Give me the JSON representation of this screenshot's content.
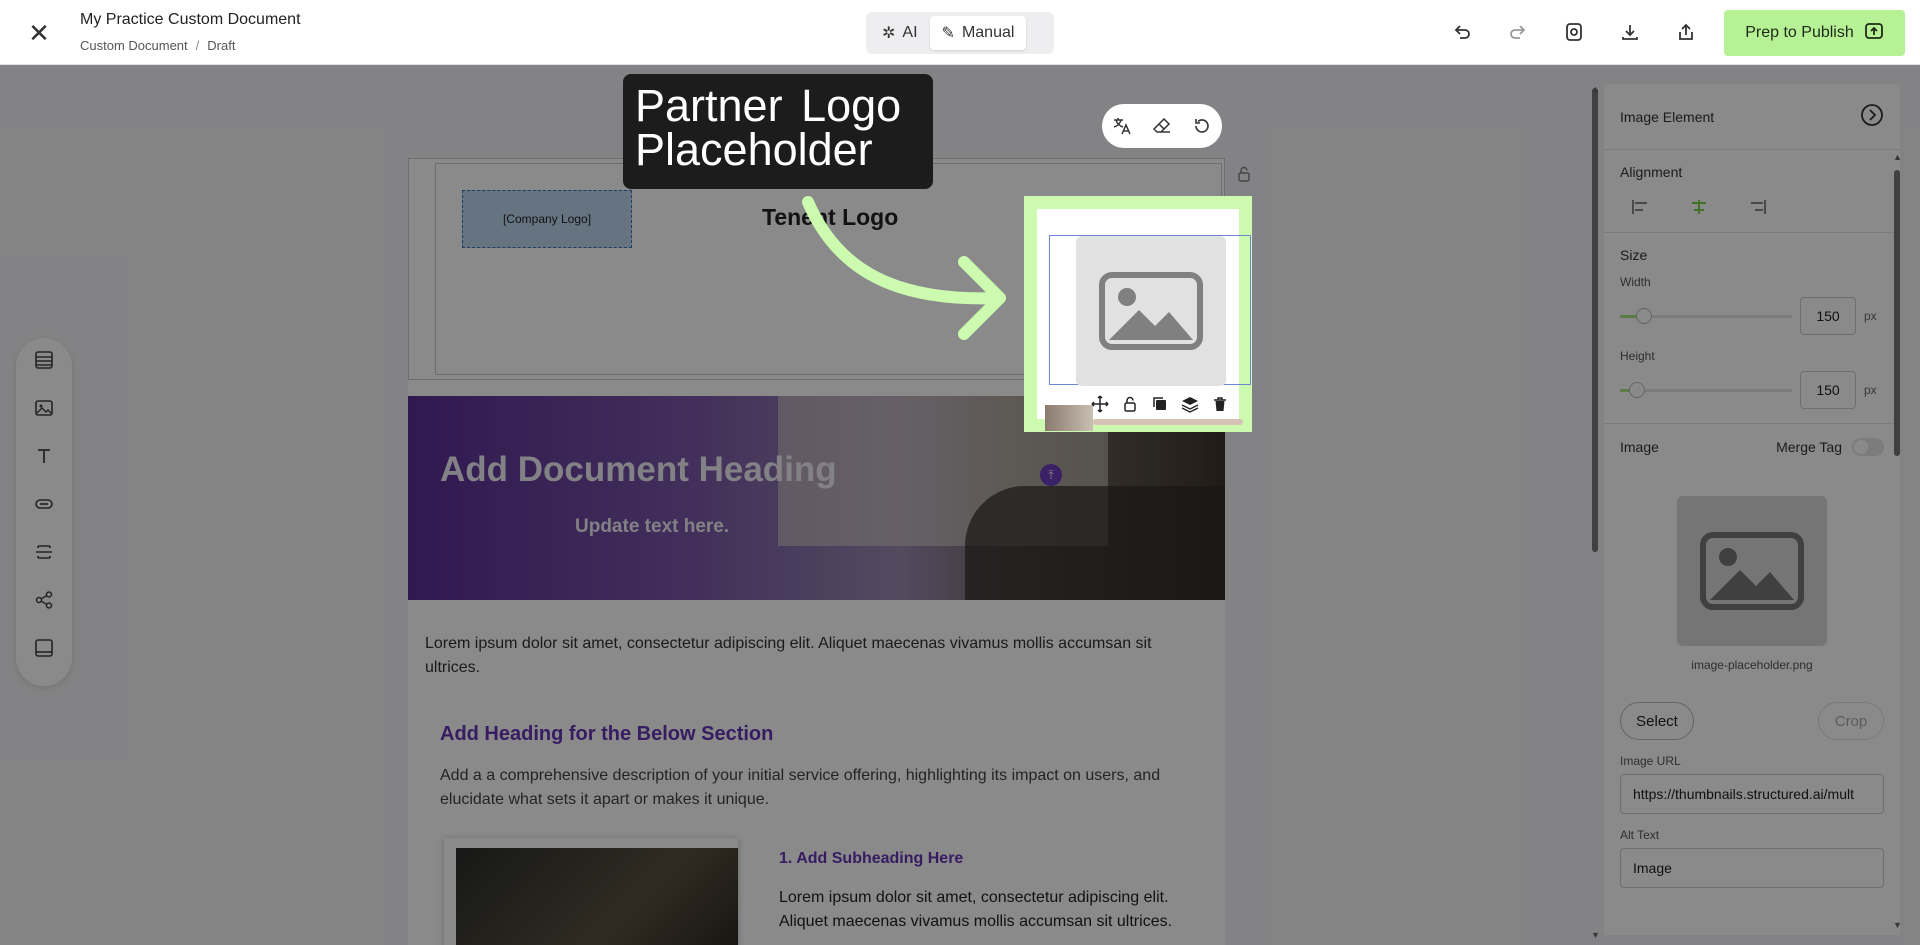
{
  "topbar": {
    "title": "My Practice Custom Document",
    "breadcrumb": [
      "Custom Document",
      "Draft"
    ],
    "mode_ai": "AI",
    "mode_manual": "Manual",
    "publish_label": "Prep to Publish"
  },
  "canvas": {
    "company_logo": "[Company Logo]",
    "tenent_logo": "Tenent Logo",
    "hero_heading": "Add Document Heading",
    "hero_sub": "Update text here.",
    "para1": "Lorem ipsum dolor sit amet, consectetur adipiscing elit. Aliquet maecenas vivamus mollis accumsan sit ultrices.",
    "section_heading": "Add Heading for the Below Section",
    "section_desc": "Add a a comprehensive description of your initial service offering, highlighting its impact on users, and elucidate what sets it apart or makes it unique.",
    "subheading": "1. Add Subheading Here",
    "sub_para": "Lorem ipsum dolor sit amet, consectetur adipiscing elit. Aliquet maecenas vivamus mollis accumsan sit ultrices."
  },
  "callout": {
    "text": "Partner Logo Placeholder"
  },
  "panel": {
    "title": "Image Element",
    "alignment_label": "Alignment",
    "size_label": "Size",
    "width_label": "Width",
    "width_value": "150",
    "height_label": "Height",
    "height_value": "150",
    "unit": "px",
    "image_label": "Image",
    "merge_tag_label": "Merge Tag",
    "filename": "image-placeholder.png",
    "select_label": "Select",
    "crop_label": "Crop",
    "image_url_label": "Image URL",
    "image_url_value": "https://thumbnails.structured.ai/mult",
    "alt_text_label": "Alt Text",
    "alt_text_value": "Image"
  },
  "colors": {
    "accent": "#b7f195",
    "highlight": "#ccfbb0",
    "heading_purple": "#6735b5"
  }
}
